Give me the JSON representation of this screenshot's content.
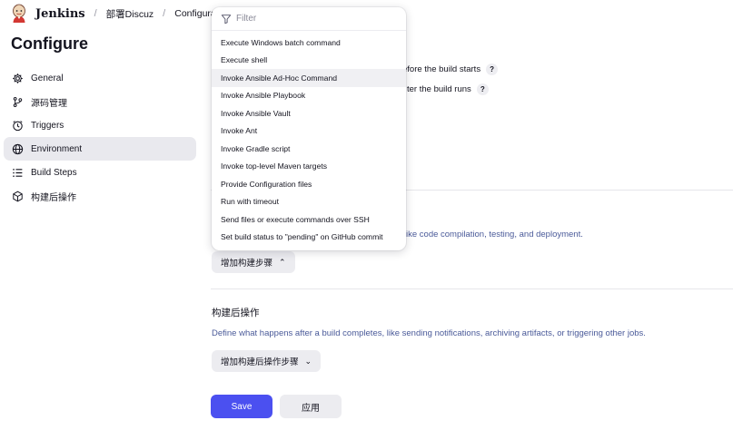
{
  "header": {
    "brand": "Jenkins",
    "breadcrumbs": [
      "部署Discuz",
      "Configuratio"
    ]
  },
  "sidebar": {
    "title": "Configure",
    "items": [
      {
        "label": "General",
        "icon": "gear-icon"
      },
      {
        "label": "源码管理",
        "icon": "branch-icon"
      },
      {
        "label": "Triggers",
        "icon": "clock-icon"
      },
      {
        "label": "Environment",
        "icon": "globe-icon",
        "active": true
      },
      {
        "label": "Build Steps",
        "icon": "list-icon"
      },
      {
        "label": "构建后操作",
        "icon": "cube-icon"
      }
    ]
  },
  "environment": {
    "option_before_build": "efore the build starts",
    "option_after_build": "ter the build runs",
    "help_symbol": "?"
  },
  "build_steps": {
    "description_fragment": "ike code compilation, testing, and deployment.",
    "add_button": "增加构建步骤",
    "add_button_chevron": "⌃"
  },
  "post_build": {
    "title": "构建后操作",
    "description": "Define what happens after a build completes, like sending notifications, archiving artifacts, or triggering other jobs.",
    "add_button": "增加构建后操作步骤",
    "add_button_chevron": "⌄"
  },
  "footer": {
    "save_label": "Save",
    "apply_label": "应用"
  },
  "dropdown": {
    "filter_placeholder": "Filter",
    "hovered_index": 2,
    "items": [
      "Execute Windows batch command",
      "Execute shell",
      "Invoke Ansible Ad-Hoc Command",
      "Invoke Ansible Playbook",
      "Invoke Ansible Vault",
      "Invoke Ant",
      "Invoke Gradle script",
      "Invoke top-level Maven targets",
      "Provide Configuration files",
      "Run with timeout",
      "Send files or execute commands over SSH",
      "Set build status to \"pending\" on GitHub commit"
    ]
  },
  "colors": {
    "accent": "#4b50f0",
    "active_nav": "#e9e9ee",
    "description_text": "#4a5a99"
  }
}
